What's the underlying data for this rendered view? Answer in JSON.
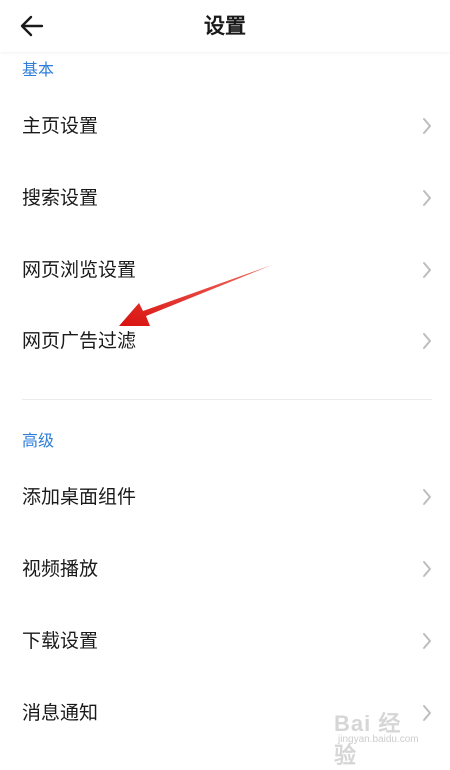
{
  "header": {
    "title": "设置",
    "back_icon": "arrow-left-icon"
  },
  "sections": [
    {
      "title": "基本",
      "items": [
        {
          "label": "主页设置"
        },
        {
          "label": "搜索设置"
        },
        {
          "label": "网页浏览设置"
        },
        {
          "label": "网页广告过滤"
        }
      ]
    },
    {
      "title": "高级",
      "items": [
        {
          "label": "添加桌面组件"
        },
        {
          "label": "视频播放"
        },
        {
          "label": "下载设置"
        },
        {
          "label": "消息通知"
        }
      ]
    }
  ],
  "colors": {
    "section_title": "#2f7ed8",
    "text": "#1a1a1a",
    "chevron": "#bdbdbd",
    "annotation_arrow": "#e8231f"
  },
  "watermark": {
    "text": "Bai 经验",
    "sub": "jingyan.baidu.com"
  }
}
